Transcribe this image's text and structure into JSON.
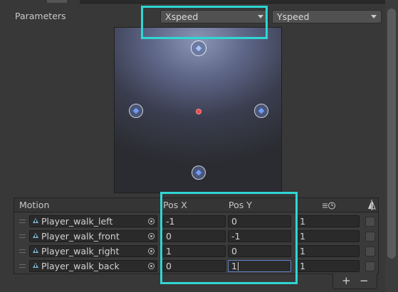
{
  "parameters": {
    "label": "Parameters",
    "x_param": "Xspeed",
    "y_param": "Yspeed"
  },
  "motion_list": {
    "header": {
      "motion": "Motion",
      "pos_x": "Pos X",
      "pos_y": "Pos Y"
    },
    "rows": [
      {
        "motion": "Player_walk_left",
        "pos_x": "-1",
        "pos_y": "0",
        "speed": "1",
        "mirror": false
      },
      {
        "motion": "Player_walk_front",
        "pos_x": "0",
        "pos_y": "-1",
        "speed": "1",
        "mirror": false
      },
      {
        "motion": "Player_walk_right",
        "pos_x": "1",
        "pos_y": "0",
        "speed": "1",
        "mirror": false
      },
      {
        "motion": "Player_walk_back",
        "pos_x": "0",
        "pos_y": "1",
        "speed": "1",
        "mirror": false
      }
    ],
    "add_label": "+",
    "remove_label": "−"
  },
  "icons": {
    "time_scale": "time-scale-icon",
    "mirror": "mirror-icon",
    "animation_clip": "animation-clip-icon",
    "object_picker": "object-picker-icon"
  },
  "colors": {
    "highlight": "#2fd6d4",
    "center_marker": "#e84c4c"
  }
}
